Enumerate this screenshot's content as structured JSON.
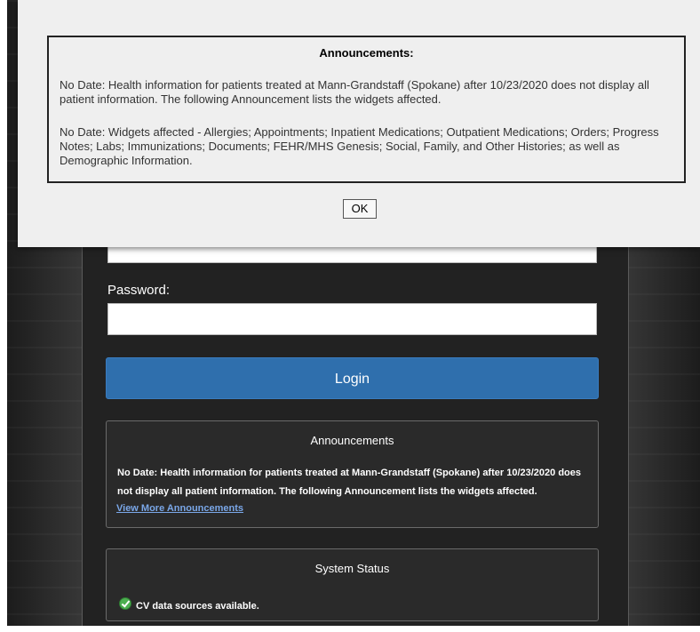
{
  "login": {
    "password_label": "Password:",
    "username_value": "",
    "password_value": "",
    "login_button": "Login"
  },
  "announcements_panel": {
    "title": "Announcements",
    "text": "No Date: Health information for patients treated at Mann-Grandstaff (Spokane) after 10/23/2020 does not display all patient information. The following Announcement lists the widgets affected.",
    "link": "View More Announcements"
  },
  "system_status": {
    "title": "System Status",
    "status_text": "CV data sources available."
  },
  "modal": {
    "title": "Announcements:",
    "paragraphs": [
      "No Date: Health information for patients treated at Mann-Grandstaff (Spokane) after 10/23/2020 does not display all patient information. The following Announcement lists the widgets affected.",
      "No Date: Widgets affected - Allergies; Appointments; Inpatient Medications; Outpatient Medications; Orders; Progress Notes; Labs; Immunizations; Documents; FEHR/MHS Genesis; Social, Family, and Other Histories; as well as Demographic Information."
    ],
    "ok_button": "OK"
  },
  "colors": {
    "login_button": "#2f6fad",
    "link": "#7aa7e8",
    "status_ok": "#4caf50"
  }
}
